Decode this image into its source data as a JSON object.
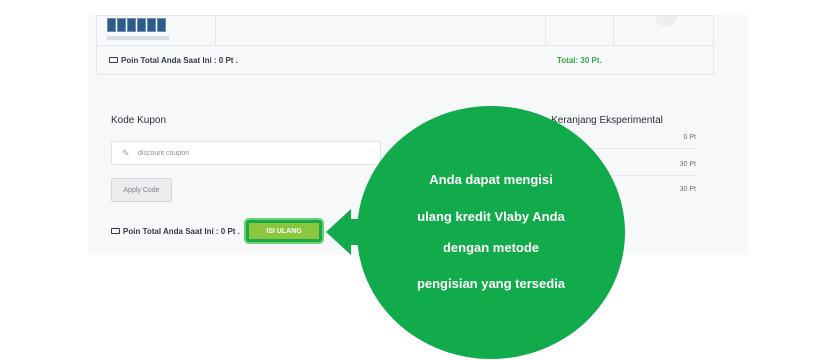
{
  "cart": {
    "points_total_label": "Poin Total Anda Saat Ini : 0 Pt .",
    "total_label": "Total: 30 Pt."
  },
  "coupon": {
    "title": "Kode Kupon",
    "placeholder": "discount coupon",
    "apply_label": "Apply Code"
  },
  "balance": {
    "points_total_label": "Poin Total Anda Saat Ini : 0 Pt .",
    "refill_label": "ISI ULANG"
  },
  "summary": {
    "title_visible": "ian Keranjang Eksperimental",
    "rows": [
      "0 Pt",
      "30 Pt",
      "30 Pt"
    ]
  },
  "callout": {
    "lines": [
      "Anda dapat mengisi",
      "ulang kredit Vlaby Anda",
      "dengan metode",
      "pengisian yang tersedia"
    ]
  },
  "colors": {
    "callout_green": "#12ab4b",
    "button_lime": "#8cc63f",
    "total_green": "#3aa64a"
  },
  "icons": [
    "card-icon",
    "pencil-icon",
    "arrow-left-icon"
  ]
}
